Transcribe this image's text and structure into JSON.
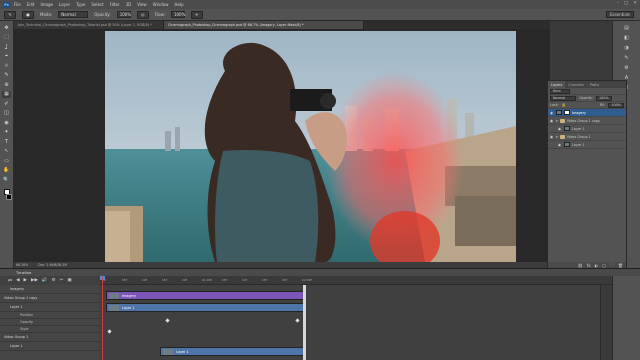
{
  "app": {
    "logo": "Ps"
  },
  "menubar": {
    "items": [
      "File",
      "Edit",
      "Image",
      "Layer",
      "Type",
      "Select",
      "Filter",
      "3D",
      "View",
      "Window",
      "Help"
    ]
  },
  "window_controls": [
    "–",
    "□",
    "✕"
  ],
  "options": {
    "mode_label": "Mode:",
    "mode_value": "Normal",
    "opacity_label": "Opacity:",
    "opacity_value": "100%",
    "flow_label": "Flow:",
    "flow_value": "100%",
    "workspace": "Essentials"
  },
  "tabs": [
    {
      "label": "Join_Technical_Cinemagraph_Photoshop_Tutorial.psd @ 50% (Layer 1, RGB/8) *",
      "active": false
    },
    {
      "label": "Cinemagraph_Photoshop_Cinemagraph.psd @ 66.7% (Imagery, Layer Mask/8) *",
      "active": true
    }
  ],
  "status": {
    "zoom": "66.26%",
    "doc": "Doc: 2.64M/58.1M"
  },
  "tools": [
    "✥",
    "⬚",
    "ʆ",
    "⌖",
    "⟐",
    "✎",
    "⊕",
    "▦",
    "✐",
    "◫",
    "◉",
    "✦",
    "T",
    "↖",
    "▭",
    "✋",
    "🔍"
  ],
  "right_rail": [
    "▤",
    "◧",
    "◑",
    "✎",
    "⚙",
    "A",
    "¶"
  ],
  "layers": {
    "tabs": [
      "Layers",
      "Channels",
      "Paths"
    ],
    "kind_label": "Kind",
    "blend": "Normal",
    "opacity_label": "Opacity:",
    "opacity_value": "100%",
    "lock_label": "Lock:",
    "fill_label": "Fill:",
    "fill_value": "100%",
    "rows": [
      {
        "name": "Imagery",
        "type": "layer-mask",
        "selected": true
      },
      {
        "name": "Video Group 1 copy",
        "type": "group",
        "selected": false
      },
      {
        "name": "Layer 1",
        "type": "layer",
        "selected": false
      },
      {
        "name": "Video Group 1",
        "type": "group",
        "selected": false
      },
      {
        "name": "Layer 1",
        "type": "layer",
        "selected": false
      }
    ],
    "footer_icons": [
      "⛓",
      "fx",
      "◐",
      "▢",
      "🗀",
      "🗑"
    ]
  },
  "timeline": {
    "title": "Timeline",
    "controls": [
      "⏮",
      "◀",
      "▶",
      "▶▶",
      "🔊",
      "⚙",
      "✂",
      "▣"
    ],
    "ruler": [
      "00",
      "05f",
      "10f",
      "15f",
      "20f",
      "01:00f",
      "05f",
      "10f",
      "15f",
      "20f",
      "02:00f"
    ],
    "tracks": [
      {
        "name": "Imagery",
        "kind": "track"
      },
      {
        "name": "Video Group 1 copy",
        "kind": "group"
      },
      {
        "name": "Layer 1",
        "kind": "track"
      },
      {
        "name": "Position",
        "kind": "prop"
      },
      {
        "name": "Opacity",
        "kind": "prop"
      },
      {
        "name": "Style",
        "kind": "prop"
      },
      {
        "name": "Video Group 1",
        "kind": "group"
      },
      {
        "name": "Layer 1",
        "kind": "track"
      }
    ],
    "clips": {
      "imagery": "Imagery",
      "layer1_copy": "Layer 1",
      "layer1": "Layer 1"
    },
    "status": "0:00:00:01 (30.00 fps)"
  },
  "colors": {
    "accent": "#2f5d8f",
    "clip_purple": "#7d55b7",
    "clip_blue": "#4e74a8",
    "playhead": "#d03a3a"
  }
}
